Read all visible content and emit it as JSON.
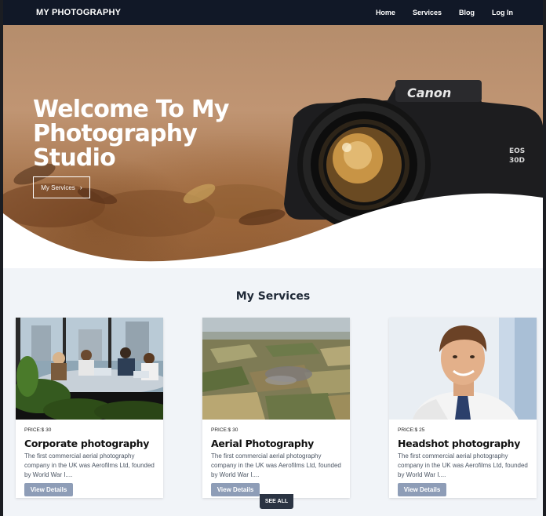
{
  "nav": {
    "brand": "MY PHOTOGRAPHY",
    "links": [
      "Home",
      "Services",
      "Blog",
      "Log In"
    ]
  },
  "hero": {
    "title": "Welcome To My Photography Studio",
    "button_label": "My Services",
    "button_icon": "chevron-right-icon",
    "camera_brand": "Canon",
    "camera_model_line1": "EOS",
    "camera_model_line2": "30D"
  },
  "services": {
    "title": "My Services",
    "cards": [
      {
        "price": "PRICE:$ 30",
        "title": "Corporate photography",
        "description": "The first commercial aerial photography company in the UK was Aerofilms Ltd, founded by World War I....",
        "button": "View Details"
      },
      {
        "price": "PRICE:$ 30",
        "title": "Aerial Photography",
        "description": "The first commercial aerial photography company in the UK was Aerofilms Ltd, founded by World War I....",
        "button": "View Details"
      },
      {
        "price": "PRICE:$ 25",
        "title": "Headshot photography",
        "description": "The first commercial aerial photography company in the UK was Aerofilms Ltd, founded by World War I....",
        "button": "View Details"
      }
    ],
    "see_all": "SEE ALL"
  },
  "colors": {
    "nav_bg": "#111827",
    "page_bg": "#f1f4f8",
    "button_bg": "#8e9db7",
    "see_all_bg": "#2b3443"
  }
}
